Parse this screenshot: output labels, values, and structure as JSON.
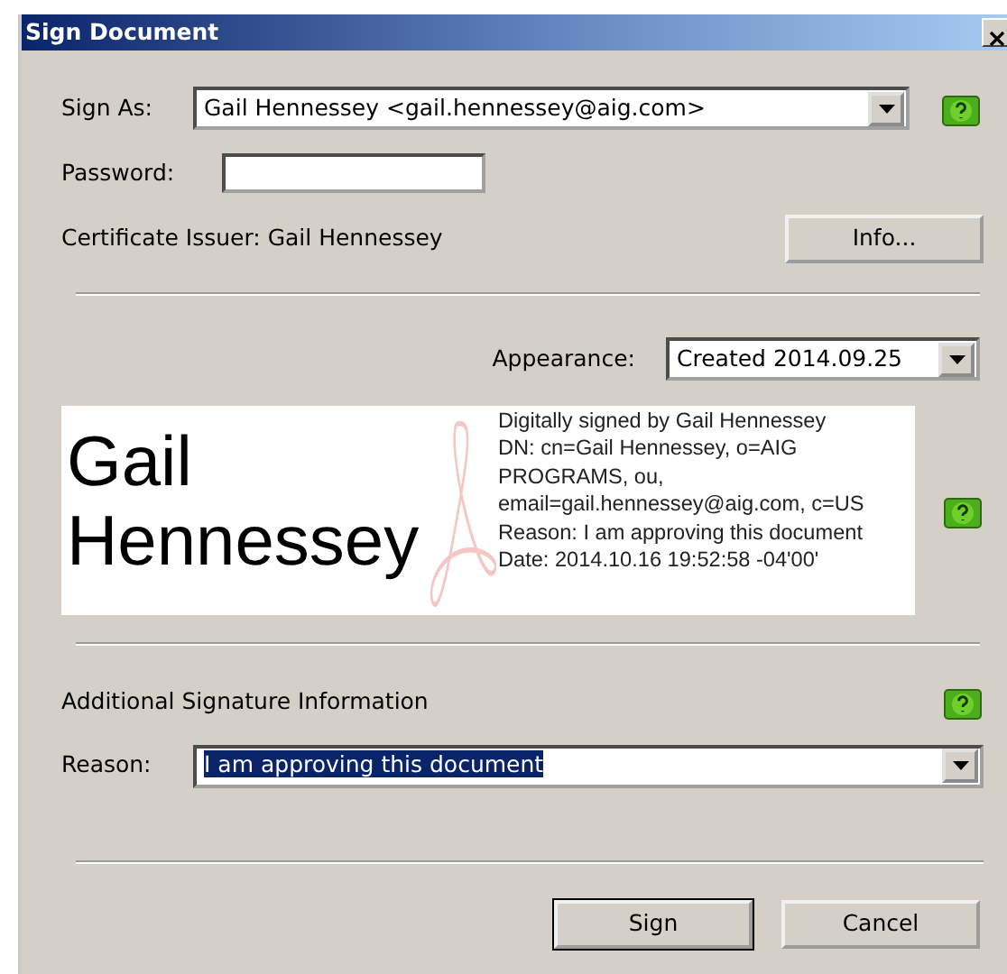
{
  "window": {
    "title": "Sign Document"
  },
  "sign_as": {
    "label": "Sign As:",
    "value": "Gail Hennessey  <gail.hennessey@aig.com>"
  },
  "password": {
    "label": "Password:"
  },
  "certificate": {
    "text": "Certificate Issuer: Gail Hennessey",
    "button": "Info..."
  },
  "appearance": {
    "label": "Appearance:",
    "value": "Created 2014.09.25"
  },
  "preview": {
    "name": "Gail Hennessey",
    "details": [
      "Digitally signed by Gail Hennessey",
      "DN: cn=Gail Hennessey, o=AIG PROGRAMS, ou, email=gail.hennessey@aig.com, c=US",
      "Reason: I am approving this document",
      "Date: 2014.10.16 19:52:58 -04'00'"
    ]
  },
  "additional": {
    "heading": "Additional Signature Information",
    "reason_label": "Reason:",
    "reason": "I am approving this document",
    "selected": true
  },
  "buttons": [
    {
      "label": "Sign",
      "default": true
    },
    {
      "label": "Cancel",
      "default": false
    }
  ]
}
